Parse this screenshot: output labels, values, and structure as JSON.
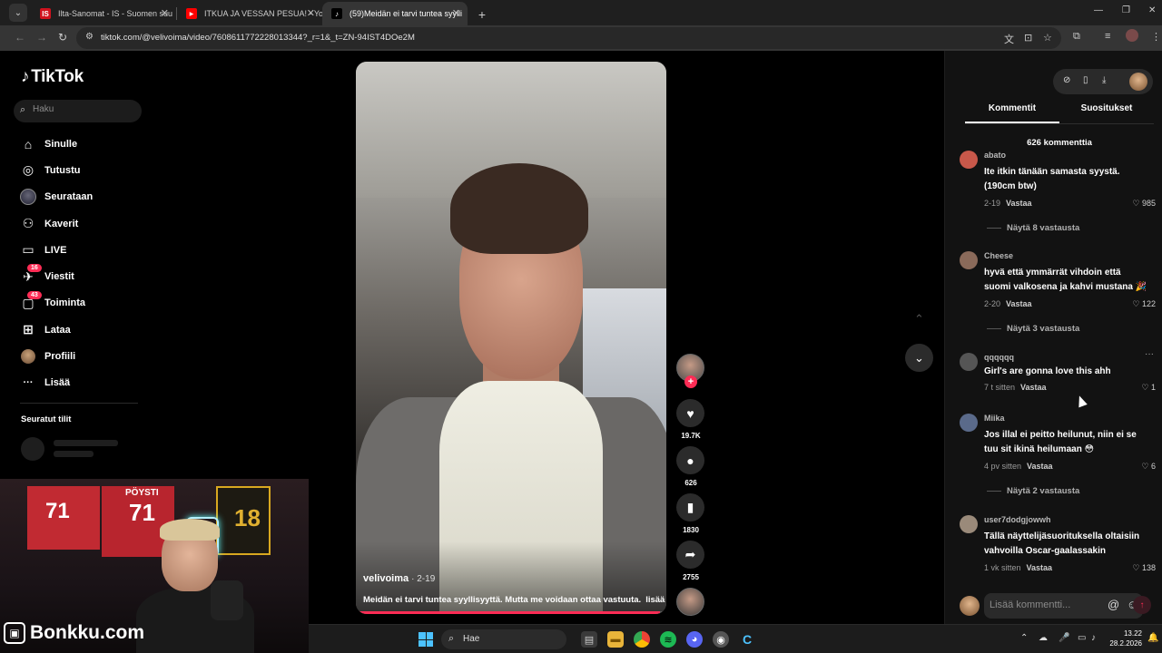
{
  "browser": {
    "tabs": [
      {
        "label": "Ilta-Sanomat - IS - Suomen suu",
        "favicon": "IS",
        "favicon_color": "#d0121e",
        "active": false
      },
      {
        "label": "ITKUA JA VESSAN PESUA! - You",
        "favicon": "▶",
        "favicon_color": "#ff0000",
        "active": false
      },
      {
        "label": "(59)Meidän ei tarvi tuntea syylli",
        "favicon": "♪",
        "favicon_color": "#000000",
        "active": true
      }
    ],
    "new_tab": "+",
    "window_controls": {
      "minimize": "—",
      "maximize": "❐",
      "close": "✕"
    },
    "url": "tiktok.com/@velivoima/video/7608611772228013344?_r=1&_t=ZN-94IST4DOe2M"
  },
  "tiktok": {
    "logo": "TikTok",
    "search_placeholder": "Haku",
    "nav": [
      {
        "label": "Sinulle",
        "icon": "home-icon",
        "glyph": "⌂"
      },
      {
        "label": "Tutustu",
        "icon": "compass-icon",
        "glyph": "◎"
      },
      {
        "label": "Seurataan",
        "icon": "following-avatar-icon",
        "glyph": ""
      },
      {
        "label": "Kaverit",
        "icon": "friends-icon",
        "glyph": "⚇"
      },
      {
        "label": "LIVE",
        "icon": "live-icon",
        "glyph": "▭"
      },
      {
        "label": "Viestit",
        "icon": "messages-icon",
        "glyph": "✈",
        "badge": "16"
      },
      {
        "label": "Toiminta",
        "icon": "activity-icon",
        "glyph": "▢",
        "badge": "43"
      },
      {
        "label": "Lataa",
        "icon": "upload-icon",
        "glyph": "⊞"
      },
      {
        "label": "Profiili",
        "icon": "profile-avatar-icon",
        "glyph": ""
      },
      {
        "label": "Lisää",
        "icon": "more-icon",
        "glyph": "···"
      }
    ],
    "followed_accounts_title": "Seuratut tilit"
  },
  "webcam": {
    "brand": "Bonkku.com",
    "jersey_left": "71",
    "jersey_name": "PÖYSTI",
    "jersey_right": "18"
  },
  "video": {
    "author": "velivoima",
    "date": "· 2-19",
    "caption": "Meidän ei tarvi tuntea syyllisyyttä. Mutta me voidaan ottaa vastuuta.",
    "more": "lisää",
    "progress": 0.98,
    "actions": {
      "likes": "19.7K",
      "comments": "626",
      "saves": "1830",
      "shares": "2755"
    }
  },
  "comments_panel": {
    "tabs": [
      "Kommentit",
      "Suositukset"
    ],
    "count_label": "626 kommenttia",
    "reply_label": "Vastaa",
    "comments": [
      {
        "user": "abato",
        "text": "Ite itkin tänään samasta syystä. (190cm btw)",
        "time": "2-19",
        "likes": "985",
        "replies": "Näytä 8 vastausta",
        "avatar_color": "#c8584a"
      },
      {
        "user": "Cheese",
        "text": "hyvä että ymmärrät vihdoin että suomi valkosena ja kahvi mustana 🎉",
        "time": "2-20",
        "likes": "122",
        "replies": "Näytä 3 vastausta",
        "avatar_color": "#8a6a5a"
      },
      {
        "user": "qqqqqq",
        "text": "Girl's are gonna love this ahh",
        "time": "7 t sitten",
        "likes": "1",
        "replies": "",
        "avatar_color": "#555555"
      },
      {
        "user": "Miika",
        "text": "Jos illal ei peitto heilunut, niin ei se tuu sit ikinä heilumaan 😳",
        "time": "4 pv sitten",
        "likes": "6",
        "replies": "Näytä 2 vastausta",
        "avatar_color": "#5a6a8a"
      },
      {
        "user": "user7dodgjowwh",
        "text": "Tällä näyttelijäsuorituksella oltaisiin vahvoilla Oscar-gaalassakin",
        "time": "1 vk sitten",
        "likes": "138",
        "replies": "",
        "avatar_color": "#9a8a7a"
      }
    ],
    "composer_placeholder": "Lisää kommentti..."
  },
  "taskbar": {
    "search_placeholder": "Hae",
    "time": "13.22",
    "date": "28.2.2026"
  }
}
